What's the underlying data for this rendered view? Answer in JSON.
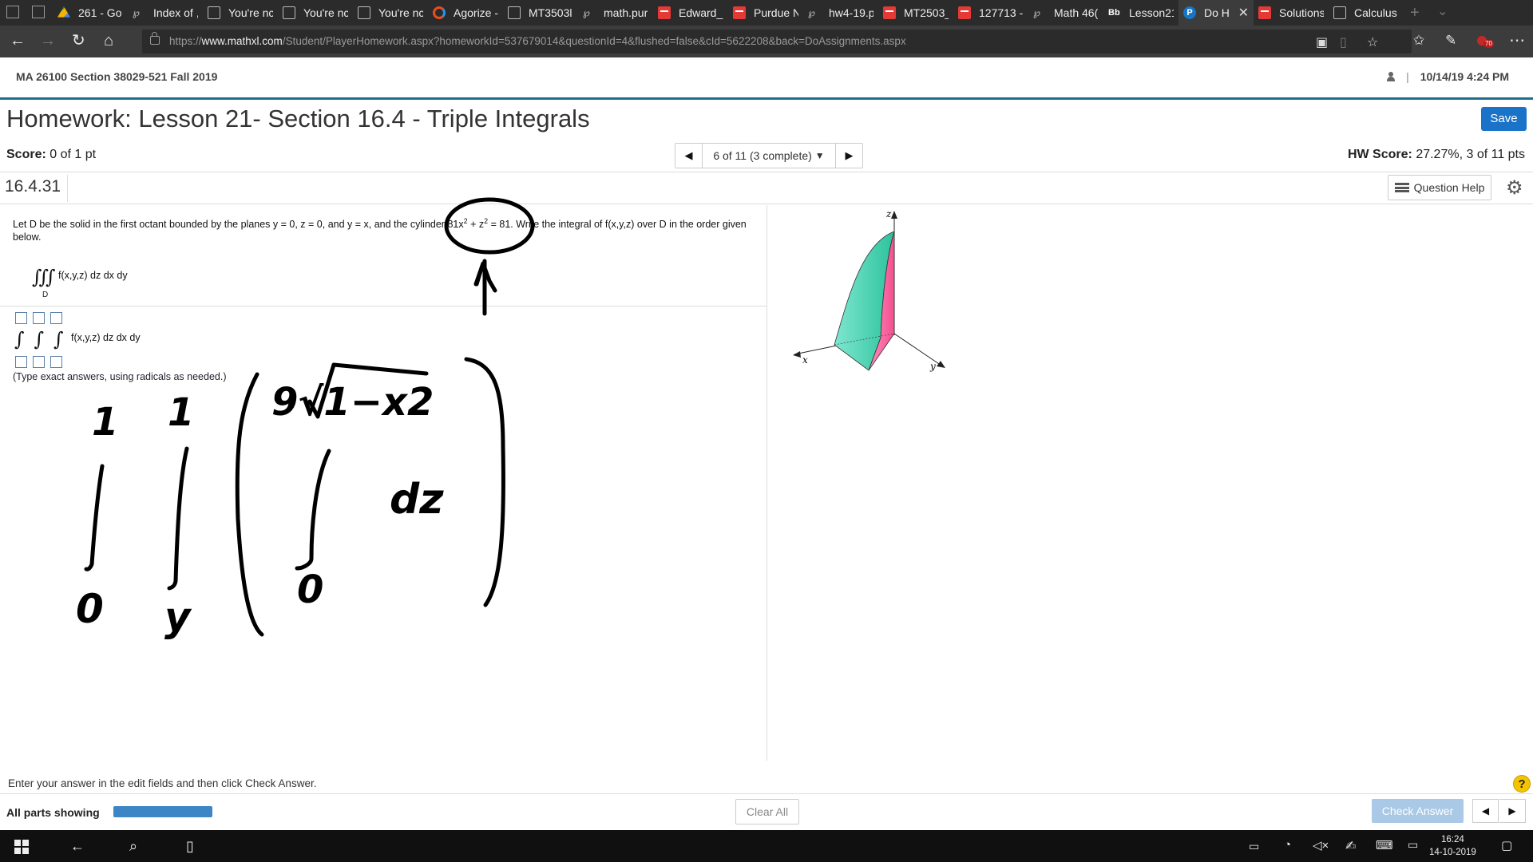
{
  "browser": {
    "tabs": [
      {
        "title": "261 - Go",
        "icon": "drive-icon",
        "active": false
      },
      {
        "title": "Index of ,",
        "icon": "jupyter-icon",
        "active": false
      },
      {
        "title": "You're nc",
        "icon": "page-icon",
        "active": false
      },
      {
        "title": "You're nc",
        "icon": "page-icon",
        "active": false
      },
      {
        "title": "You're nc",
        "icon": "page-icon",
        "active": false
      },
      {
        "title": "Agorize -",
        "icon": "agorize-icon",
        "active": false
      },
      {
        "title": "MT3503l",
        "icon": "page-icon",
        "active": false
      },
      {
        "title": "math.pur",
        "icon": "jupyter-icon",
        "active": false
      },
      {
        "title": "Edward_I",
        "icon": "pdf-icon",
        "active": false
      },
      {
        "title": "Purdue N",
        "icon": "pdf-icon",
        "active": false
      },
      {
        "title": "hw4-19.p",
        "icon": "jupyter-icon",
        "active": false
      },
      {
        "title": "MT2503_",
        "icon": "pdf-icon",
        "active": false
      },
      {
        "title": "127713 -",
        "icon": "pdf-icon",
        "active": false
      },
      {
        "title": "Math 46(",
        "icon": "jupyter-icon",
        "active": false
      },
      {
        "title": "Lesson21",
        "icon": "blackboard-icon",
        "active": false
      },
      {
        "title": "Do H",
        "icon": "pearson-icon",
        "active": true
      },
      {
        "title": "Solutions",
        "icon": "pdf-icon",
        "active": false
      },
      {
        "title": "Calculus",
        "icon": "page-icon",
        "active": false
      }
    ],
    "url_prefix": "https://",
    "url_domain": "www.mathxl.com",
    "url_path": "/Student/PlayerHomework.aspx?homeworkId=537679014&questionId=4&flushed=false&cId=5622208&back=DoAssignments.aspx",
    "notification_badge": "70"
  },
  "header": {
    "course": "MA 26100 Section 38029-521 Fall 2019",
    "separator": "|",
    "datetime": "10/14/19 4:24 PM",
    "title": "Homework: Lesson 21- Section 16.4 - Triple Integrals",
    "save_label": "Save"
  },
  "status": {
    "score_label": "Score:",
    "score_value": "0 of 1 pt",
    "question_position": "6 of 11 (3 complete)",
    "hw_score_label": "HW Score:",
    "hw_score_value": "27.27%, 3 of 11 pts",
    "question_number": "16.4.31",
    "question_help_label": "Question Help"
  },
  "question": {
    "text_part1": "Let D be the solid in the first octant bounded by the planes y = 0, z = 0, and y = x, and the cylinder 81x",
    "sup1": "2",
    "text_part2": " + z",
    "sup2": "2",
    "text_part3": " = 81. Write the integral of f(x,y,z) over D in the order given below.",
    "given_integrand": "f(x,y,z) dz dx dy",
    "given_region": "D",
    "answer_integrand": "f(x,y,z) dz dx dy",
    "hint": "(Type exact answers, using radicals as needed.)"
  },
  "figure": {
    "axis_x": "x",
    "axis_y": "y",
    "axis_z": "z",
    "colors": {
      "curved_face": "#4fd8b8",
      "flat_face": "#f56aa8"
    }
  },
  "handwriting": {
    "outer_upper": "1",
    "outer_lower": "0",
    "middle_upper": "1",
    "middle_lower": "y",
    "inner_upper": "9√1−x2",
    "inner_lower": "0",
    "differential": "dz"
  },
  "footer": {
    "instruction": "Enter your answer in the edit fields and then click Check Answer.",
    "parts_label": "All parts showing",
    "progress_fraction": 1.0,
    "clear_all_label": "Clear All",
    "check_answer_label": "Check Answer"
  },
  "taskbar": {
    "time": "16:24",
    "date": "14-10-2019"
  }
}
